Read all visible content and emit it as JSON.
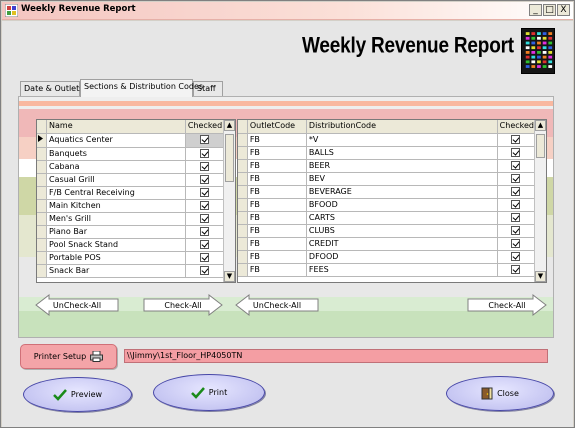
{
  "window": {
    "title": "Weekly Revenue Report",
    "controls": [
      "_",
      "□",
      "X"
    ]
  },
  "header": {
    "banner": "Weekly Revenue Report"
  },
  "tabs": [
    {
      "label": "Date & Outlets",
      "active": false
    },
    {
      "label": "Sections & Distribution Codes",
      "active": true
    },
    {
      "label": "Staff",
      "active": false
    }
  ],
  "sections_grid": {
    "columns": [
      "Name",
      "Checked"
    ],
    "rows": [
      {
        "name": "Aquatics Center",
        "checked": true,
        "current": true
      },
      {
        "name": "Banquets",
        "checked": true
      },
      {
        "name": "Cabana",
        "checked": true
      },
      {
        "name": "Casual Grill",
        "checked": true
      },
      {
        "name": "F/B Central Receiving",
        "checked": true
      },
      {
        "name": "Main Kitchen",
        "checked": true
      },
      {
        "name": "Men's Grill",
        "checked": true
      },
      {
        "name": "Piano Bar",
        "checked": true
      },
      {
        "name": "Pool Snack Stand",
        "checked": true
      },
      {
        "name": "Portable POS",
        "checked": true
      },
      {
        "name": "Snack Bar",
        "checked": true
      }
    ]
  },
  "dist_grid": {
    "columns": [
      "OutletCode",
      "DistributionCode",
      "Checked"
    ],
    "rows": [
      {
        "outlet": "FB",
        "code": "*V",
        "checked": true
      },
      {
        "outlet": "FB",
        "code": "BALLS",
        "checked": true
      },
      {
        "outlet": "FB",
        "code": "BEER",
        "checked": true
      },
      {
        "outlet": "FB",
        "code": "BEV",
        "checked": true
      },
      {
        "outlet": "FB",
        "code": "BEVERAGE",
        "checked": true
      },
      {
        "outlet": "FB",
        "code": "BFOOD",
        "checked": true
      },
      {
        "outlet": "FB",
        "code": "CARTS",
        "checked": true
      },
      {
        "outlet": "FB",
        "code": "CLUBS",
        "checked": true
      },
      {
        "outlet": "FB",
        "code": "CREDIT",
        "checked": true
      },
      {
        "outlet": "FB",
        "code": "DFOOD",
        "checked": true
      },
      {
        "outlet": "FB",
        "code": "FEES",
        "checked": true
      }
    ]
  },
  "left_actions": {
    "uncheck_all": "UnCheck-All",
    "check_all": "Check-All"
  },
  "right_actions": {
    "uncheck_all": "UnCheck-All",
    "check_all": "Check-All"
  },
  "printer": {
    "setup_label": "Printer Setup",
    "path": "\\\\Jimmy\\1st_Floor_HP4050TN"
  },
  "buttons": {
    "preview": "Preview",
    "print": "Print",
    "close": "Close"
  },
  "colors": {
    "oval_button": "#c6c6f2",
    "printer_field": "#f49ea3",
    "titlebar": "#f4c5c0"
  }
}
